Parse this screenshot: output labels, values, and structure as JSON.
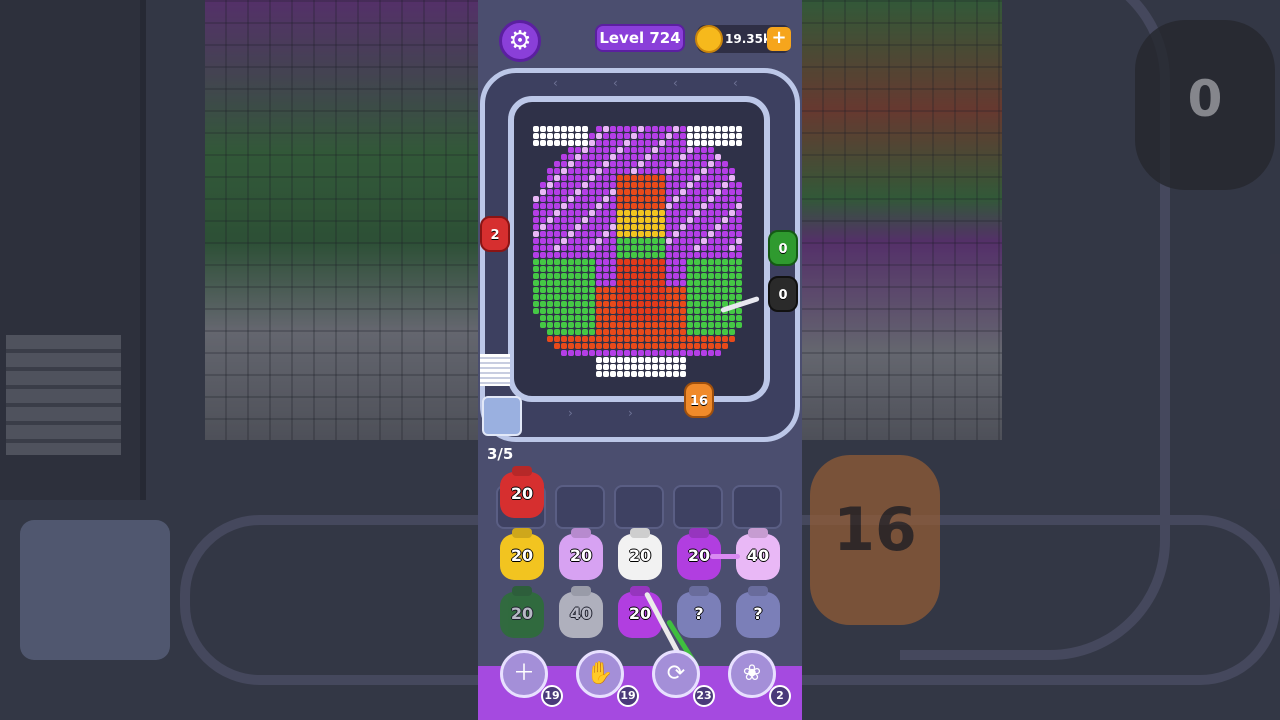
{
  "topbar": {
    "settings_icon": "gear-icon",
    "level_label": "Level 724",
    "coins": "19.35k",
    "coins_plus": "+"
  },
  "board": {
    "belt_bags": [
      {
        "name": "belt-bag-red",
        "count": "2",
        "color": "#d62f2f"
      },
      {
        "name": "belt-bag-green",
        "count": "0",
        "color": "#2f9a2f"
      },
      {
        "name": "belt-bag-black",
        "count": "0",
        "color": "#2a2a2a"
      },
      {
        "name": "belt-bag-orange",
        "count": "16",
        "color": "#f08a2a"
      }
    ],
    "progress": "3/5"
  },
  "queue": {
    "slots": [
      {
        "count": "20",
        "color": "#d62f2f",
        "filled": true
      },
      {
        "count": "",
        "filled": false
      },
      {
        "count": "",
        "filled": false
      },
      {
        "count": "",
        "filled": false
      },
      {
        "count": "",
        "filled": false
      }
    ],
    "rows": [
      [
        {
          "count": "20",
          "color": "#f2c420"
        },
        {
          "count": "20",
          "color": "#d7a2f2"
        },
        {
          "count": "20",
          "color": "#f2f2f2"
        },
        {
          "count": "20",
          "color": "#b13ee0"
        },
        {
          "count": "40",
          "color": "#e9b8f6"
        }
      ],
      [
        {
          "count": "20",
          "color": "#1f7d1f",
          "dim": true
        },
        {
          "count": "40",
          "color": "#f2f2f2",
          "dim": true
        },
        {
          "count": "20",
          "color": "#b13ee0"
        },
        {
          "count": "?",
          "color": "#7b7fb8"
        },
        {
          "count": "?",
          "color": "#7b7fb8"
        }
      ]
    ]
  },
  "boosters": [
    {
      "name": "add-slot-booster",
      "icon": "＋",
      "count": "19"
    },
    {
      "name": "hand-booster",
      "icon": "✋",
      "count": "19"
    },
    {
      "name": "shuffle-booster",
      "icon": "⟳",
      "count": "23"
    },
    {
      "name": "bunny-booster",
      "icon": "❀",
      "count": "2"
    }
  ],
  "backdrop": {
    "big_bag_count": "16",
    "black_bag_count": "0"
  }
}
